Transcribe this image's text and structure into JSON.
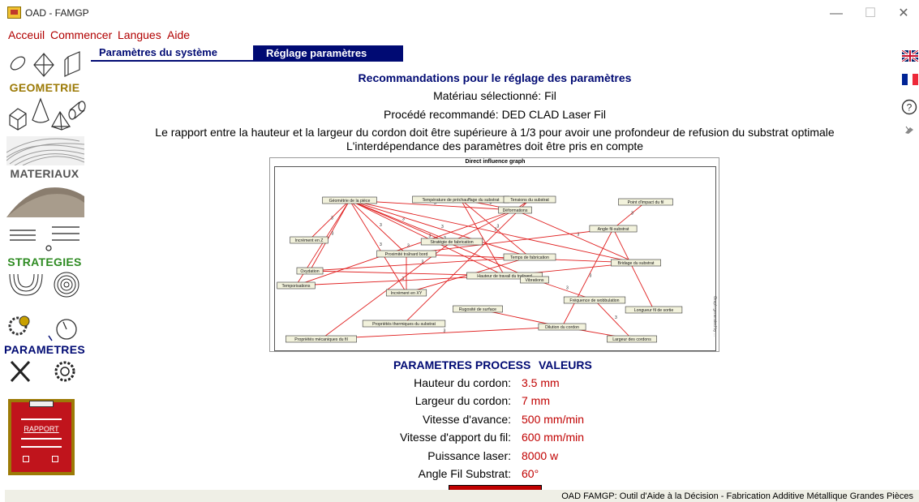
{
  "window": {
    "title": "OAD - FAMGP",
    "minimize": "—",
    "maximize": "☐",
    "close": "✕"
  },
  "menu": [
    "Acceuil",
    "Commencer",
    "Langues",
    "Aide"
  ],
  "sidebar": {
    "geometry": "GEOMETRIE",
    "materials": "MATERIAUX",
    "strategies": "STRATEGIES",
    "parameters": "PARAMETRES",
    "report": "RAPPORT",
    "colors": {
      "gold": "#9c7a06",
      "green": "#2e8b22",
      "blue": "#000a73",
      "report_red": "#c0141c"
    }
  },
  "tabs": {
    "system": "Paramètres du système",
    "settings": "Réglage paramètres",
    "active": "settings"
  },
  "right_icons": [
    "uk-flag-icon",
    "fr-flag-icon",
    "help-icon",
    "tool-icon"
  ],
  "content": {
    "heading": "Recommandations pour le réglage des paramètres",
    "material": "Matériau sélectionné: Fil",
    "process": "Procédé recommandé: DED CLAD Laser Fil",
    "ratio_note": "Le rapport entre la hauteur et la largeur du cordon doit être supérieure à 1/3 pour avoir une profondeur de refusion du substrat optimale",
    "interdependence_note": "L'interdépendance des paramètres doit être pris en compte"
  },
  "graph": {
    "title": "Direct influence graph",
    "side_text": "Graph generated by ...",
    "nodes": [
      {
        "id": "geo",
        "label": "Géométrie de la pièce",
        "c": [
          430,
          246
        ]
      },
      {
        "id": "temp",
        "label": "Température de préchauffage du substrat",
        "c": [
          567,
          245
        ]
      },
      {
        "id": "tens",
        "label": "Tensions du substrat",
        "c": [
          652,
          245
        ]
      },
      {
        "id": "pimp",
        "label": "Point d'impact du fil",
        "c": [
          795,
          248
        ]
      },
      {
        "id": "def",
        "label": "Déformations",
        "c": [
          634,
          258
        ]
      },
      {
        "id": "ang",
        "label": "Angle fil-substrat",
        "c": [
          755,
          281
        ]
      },
      {
        "id": "incz",
        "label": "Incrément en Z",
        "c": [
          380,
          295
        ]
      },
      {
        "id": "strat",
        "label": "Stratégie de fabrication",
        "c": [
          556,
          297
        ]
      },
      {
        "id": "prox",
        "label": "Proximité traînard bord",
        "c": [
          500,
          312
        ]
      },
      {
        "id": "tfab",
        "label": "Temps de fabrication",
        "c": [
          652,
          316
        ]
      },
      {
        "id": "brid",
        "label": "Bridage du substrat",
        "c": [
          783,
          323
        ]
      },
      {
        "id": "oxy",
        "label": "Oxydation",
        "c": [
          381,
          333
        ]
      },
      {
        "id": "htrav",
        "label": "Hauteur de travail du traînard",
        "c": [
          621,
          339
        ]
      },
      {
        "id": "vib",
        "label": "Vibrations",
        "c": [
          658,
          344
        ]
      },
      {
        "id": "tempo",
        "label": "Temporisations",
        "c": [
          364,
          351
        ]
      },
      {
        "id": "incxy",
        "label": "Incrément en XY",
        "c": [
          500,
          360
        ]
      },
      {
        "id": "freq",
        "label": "Fréquence de wobbulation",
        "c": [
          732,
          369
        ]
      },
      {
        "id": "rug",
        "label": "Rugosité de surface",
        "c": [
          588,
          380
        ]
      },
      {
        "id": "long",
        "label": "Longueur fil de sortie",
        "c": [
          805,
          381
        ]
      },
      {
        "id": "pth",
        "label": "Propriétés thermiques du substrat",
        "c": [
          497,
          398
        ]
      },
      {
        "id": "dil",
        "label": "Dilution du cordon",
        "c": [
          692,
          402
        ]
      },
      {
        "id": "pmec",
        "label": "Propriétés mécaniques du fil",
        "c": [
          395,
          417
        ]
      },
      {
        "id": "larg",
        "label": "Largeur des cordons",
        "c": [
          778,
          417
        ]
      }
    ],
    "edges": [
      [
        "geo",
        "incz",
        "3"
      ],
      [
        "geo",
        "strat",
        "3"
      ],
      [
        "geo",
        "def",
        "3"
      ],
      [
        "geo",
        "tfab",
        "3"
      ],
      [
        "geo",
        "brid",
        "3"
      ],
      [
        "geo",
        "prox",
        "3"
      ],
      [
        "geo",
        "oxy",
        "3"
      ],
      [
        "geo",
        "htrav",
        "3"
      ],
      [
        "geo",
        "vib",
        "3"
      ],
      [
        "geo",
        "tempo",
        "2"
      ],
      [
        "geo",
        "incxy",
        "3"
      ],
      [
        "temp",
        "def",
        "3"
      ],
      [
        "temp",
        "tfab",
        "3"
      ],
      [
        "temp",
        "htrav",
        ""
      ],
      [
        "tens",
        "def",
        "3"
      ],
      [
        "tens",
        "pth",
        ""
      ],
      [
        "pimp",
        "ang",
        "3"
      ],
      [
        "def",
        "brid",
        "3"
      ],
      [
        "def",
        "tempo",
        "3"
      ],
      [
        "def",
        "strat",
        ""
      ],
      [
        "ang",
        "dil",
        "3"
      ],
      [
        "ang",
        "long",
        ""
      ],
      [
        "ang",
        "prox",
        ""
      ],
      [
        "prox",
        "brid",
        "3"
      ],
      [
        "oxy",
        "tfab",
        "3"
      ],
      [
        "oxy",
        "htrav",
        ""
      ],
      [
        "htrav",
        "tempo",
        "3"
      ],
      [
        "htrav",
        "brid",
        ""
      ],
      [
        "vib",
        "freq",
        "3"
      ],
      [
        "freq",
        "larg",
        "3"
      ],
      [
        "rug",
        "dil",
        ""
      ],
      [
        "pmec",
        "dil",
        "3"
      ],
      [
        "dil",
        "larg",
        ""
      ],
      [
        "prox",
        "incxy",
        ""
      ],
      [
        "strat",
        "pmec",
        ""
      ],
      [
        "tfab",
        "incxy",
        ""
      ]
    ]
  },
  "params": {
    "header_left": "PARAMETRES PROCESS",
    "header_right": "VALEURS",
    "rows": [
      {
        "label": "Hauteur du cordon:",
        "value": "3.5 mm"
      },
      {
        "label": "Largeur du cordon:",
        "value": "7 mm"
      },
      {
        "label": "Vitesse d'avance:",
        "value": "500 mm/min"
      },
      {
        "label": "Vitesse d'apport du fil:",
        "value": "600 mm/min"
      },
      {
        "label": "Puissance laser:",
        "value": "8000 w"
      },
      {
        "label": "Angle Fil Substrat:",
        "value": "60°"
      }
    ]
  },
  "status": "OAD FAMGP: Outil d'Aide à la Décision - Fabrication Additive Métallique Grandes Pièces"
}
